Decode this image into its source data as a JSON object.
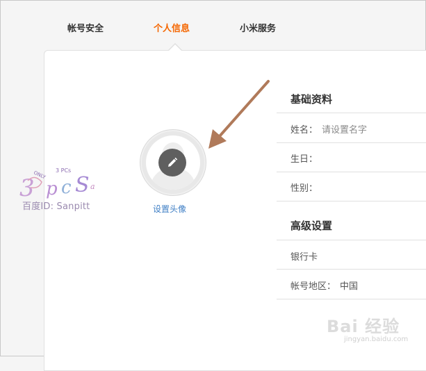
{
  "tabs": [
    {
      "label": "帐号安全",
      "active": false
    },
    {
      "label": "个人信息",
      "active": true
    },
    {
      "label": "小米服务",
      "active": false
    }
  ],
  "avatar": {
    "link_label": "设置头像",
    "edit_icon": "pencil-icon"
  },
  "basic_info": {
    "title": "基础资料",
    "name_label": "姓名：",
    "name_placeholder": "请设置名字",
    "birthday_label": "生日：",
    "gender_label": "性别："
  },
  "advanced": {
    "title": "高级设置",
    "bank_card_label": "银行卡",
    "region_label": "帐号地区：",
    "region_value": "中国"
  },
  "watermark": {
    "text": "百度ID: Sanpitt"
  },
  "baidu_watermark": {
    "logo": "Bai 经验",
    "url": "jingyan.baidu.com"
  },
  "colors": {
    "accent": "#f56600",
    "link": "#3f7fc5",
    "arrow": "#b07a5a"
  }
}
